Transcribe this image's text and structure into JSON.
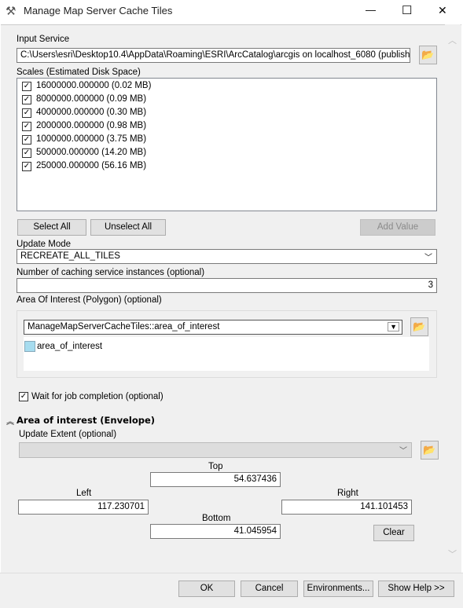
{
  "window": {
    "title": "Manage Map Server Cache Tiles",
    "minimize": "—",
    "maximize": "☐",
    "close": "✕"
  },
  "input_service": {
    "label": "Input Service",
    "value": "C:\\Users\\esri\\Desktop10.4\\AppData\\Roaming\\ESRI\\ArcCatalog\\arcgis on localhost_6080 (publisher)\\C"
  },
  "scales": {
    "label": "Scales (Estimated Disk Space)",
    "items": [
      {
        "label": "16000000.000000 (0.02 MB)",
        "checked": true
      },
      {
        "label": "8000000.000000 (0.09 MB)",
        "checked": true
      },
      {
        "label": "4000000.000000 (0.30 MB)",
        "checked": true
      },
      {
        "label": "2000000.000000 (0.98 MB)",
        "checked": true
      },
      {
        "label": "1000000.000000 (3.75 MB)",
        "checked": true
      },
      {
        "label": "500000.000000 (14.20 MB)",
        "checked": true
      },
      {
        "label": "250000.000000 (56.16 MB)",
        "checked": true
      }
    ],
    "select_all": "Select All",
    "unselect_all": "Unselect All",
    "add_value": "Add Value"
  },
  "update_mode": {
    "label": "Update Mode",
    "value": "RECREATE_ALL_TILES"
  },
  "instances": {
    "label": "Number of caching service instances (optional)",
    "value": "3"
  },
  "aoi_polygon": {
    "label": "Area Of Interest (Polygon) (optional)",
    "combo_value": "ManageMapServerCacheTiles::area_of_interest",
    "layer": "area_of_interest",
    "swatch_color": "#a6dcef"
  },
  "wait": {
    "label": "Wait for job completion (optional)",
    "checked": true
  },
  "envelope": {
    "section_title": "Area of interest (Envelope)",
    "update_extent_label": "Update Extent (optional)",
    "update_extent_value": "",
    "top_label": "Top",
    "top": "54.637436",
    "left_label": "Left",
    "left": "117.230701",
    "right_label": "Right",
    "right": "141.101453",
    "bottom_label": "Bottom",
    "bottom": "41.045954",
    "clear": "Clear"
  },
  "footer": {
    "ok": "OK",
    "cancel": "Cancel",
    "environments": "Environments...",
    "show_help": "Show Help >>"
  }
}
